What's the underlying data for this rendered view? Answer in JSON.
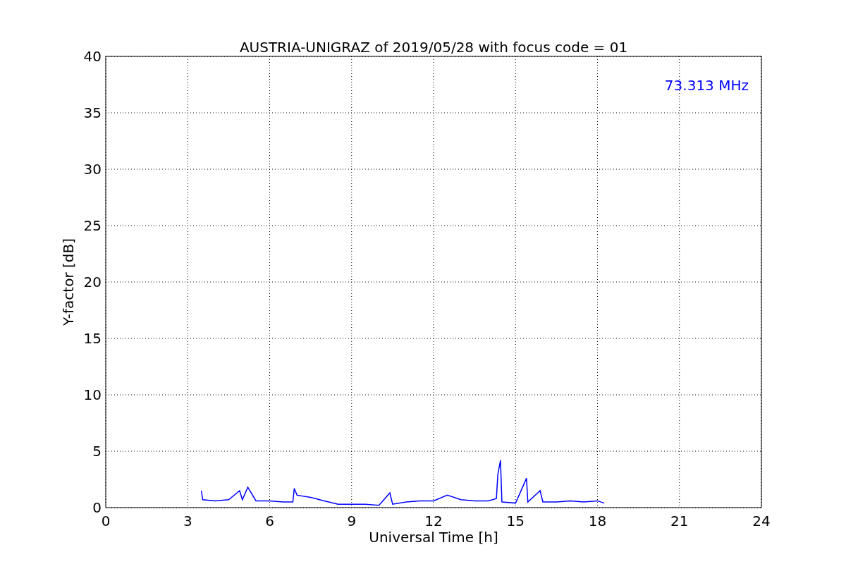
{
  "figure": {
    "chart_data": {
      "type": "line",
      "title": "AUSTRIA-UNIGRAZ of 2019/05/28 with focus code = 01",
      "xlabel": "Universal Time [h]",
      "ylabel": "Y-factor [dB]",
      "x": [
        3.5,
        3.55,
        4,
        4.5,
        4.9,
        5,
        5.2,
        5.5,
        6,
        6.5,
        6.85,
        6.9,
        7,
        7.5,
        8,
        8.5,
        9,
        9.5,
        10,
        10.4,
        10.5,
        11,
        11.5,
        12,
        12.5,
        13,
        13.5,
        14,
        14.3,
        14.35,
        14.45,
        14.5,
        15,
        15.4,
        15.45,
        15.9,
        16,
        16.5,
        17,
        17.5,
        18,
        18.25
      ],
      "series": [
        {
          "name": "73.313 MHz",
          "color": "#0000ff",
          "values": [
            1.5,
            0.7,
            0.6,
            0.7,
            1.5,
            0.7,
            1.8,
            0.6,
            0.6,
            0.5,
            0.5,
            1.7,
            1.1,
            0.9,
            0.6,
            0.3,
            0.3,
            0.3,
            0.2,
            1.3,
            0.3,
            0.5,
            0.6,
            0.6,
            1.1,
            0.7,
            0.6,
            0.6,
            0.8,
            2.9,
            4.2,
            0.5,
            0.4,
            2.6,
            0.5,
            1.5,
            0.5,
            0.5,
            0.6,
            0.5,
            0.6,
            0.4
          ]
        }
      ],
      "xlim": [
        0,
        24
      ],
      "ylim": [
        0,
        40
      ],
      "xticks": [
        0,
        3,
        6,
        9,
        12,
        15,
        18,
        21,
        24
      ],
      "yticks": [
        0,
        5,
        10,
        15,
        20,
        25,
        30,
        35,
        40
      ],
      "grid": true
    }
  }
}
